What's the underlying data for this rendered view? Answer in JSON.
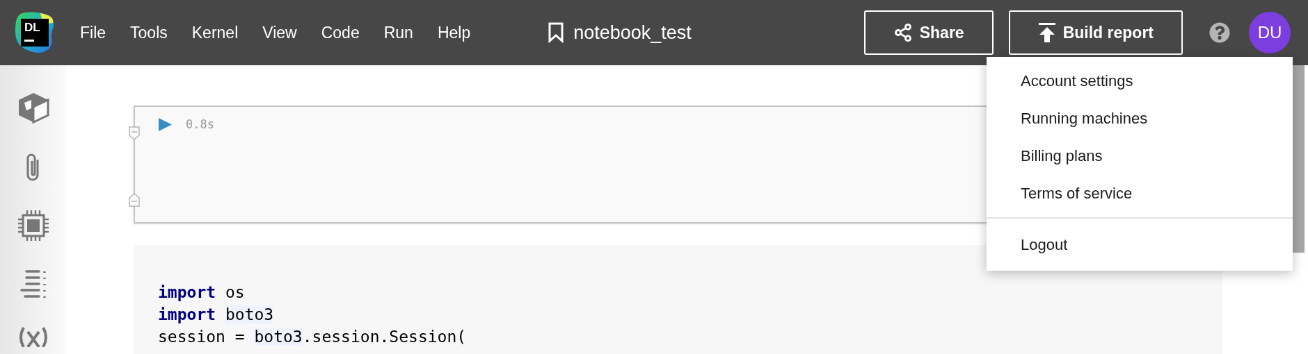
{
  "logo": {
    "text": "DL"
  },
  "menu": [
    "File",
    "Tools",
    "Kernel",
    "View",
    "Code",
    "Run",
    "Help"
  ],
  "notebook": {
    "title": "notebook_test"
  },
  "actions": [
    {
      "label": "Share",
      "kind": "share"
    },
    {
      "label": "Build report",
      "kind": "report"
    }
  ],
  "avatar": {
    "initials": "DU"
  },
  "output_cell": {
    "time": "0.8s"
  },
  "code_cell": {
    "lines": [
      [
        {
          "text": "import",
          "kind": "keyword"
        },
        {
          "text": " os",
          "kind": "plain"
        }
      ],
      [
        {
          "text": "import ",
          "kind": "keyword"
        },
        {
          "text": "boto3",
          "kind": "ref"
        }
      ],
      [
        {
          "text": "session = ",
          "kind": "plain"
        },
        {
          "text": "boto3",
          "kind": "ref"
        },
        {
          "text": ".session.Session(",
          "kind": "plain"
        }
      ]
    ]
  },
  "account_menu": {
    "groups": [
      [
        "Account settings",
        "Running machines",
        "Billing plans",
        "Terms of service"
      ],
      [
        "Logout"
      ]
    ]
  }
}
